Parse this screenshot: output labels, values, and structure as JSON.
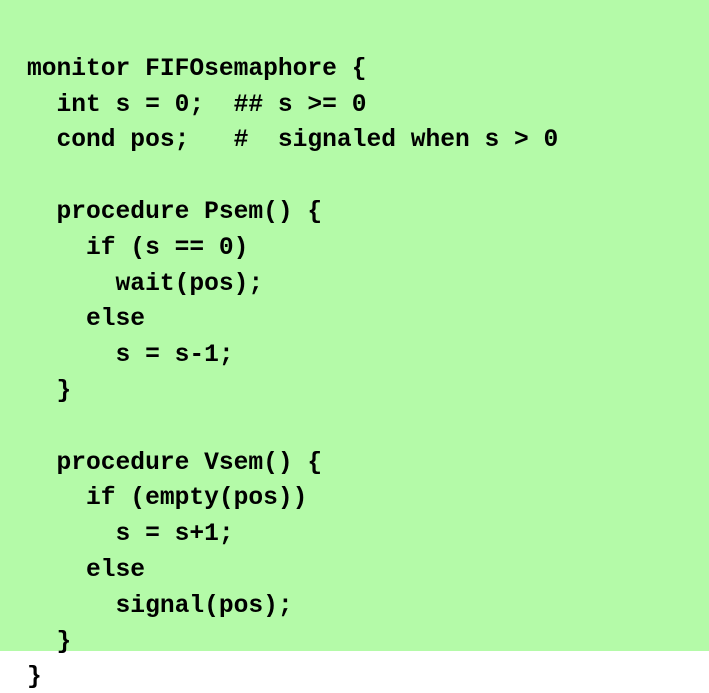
{
  "slide": {
    "background_color": "#b4faa8",
    "text_color": "#000000",
    "language": "monitor-pseudocode",
    "monitor_name": "FIFOsemaphore"
  },
  "code": {
    "full_text": "monitor FIFOsemaphore {\n  int s = 0;  ## s >= 0\n  cond pos;   #  signaled when s > 0\n\n  procedure Psem() {\n    if (s == 0)\n      wait(pos);\n    else\n      s = s-1;\n  }\n\n  procedure Vsem() {\n    if (empty(pos))\n      s = s+1;\n    else\n      signal(pos);\n  }\n}",
    "lines": [
      "monitor FIFOsemaphore {",
      "  int s = 0;  ## s >= 0",
      "  cond pos;   #  signaled when s > 0",
      "",
      "  procedure Psem() {",
      "    if (s == 0)",
      "      wait(pos);",
      "    else",
      "      s = s-1;",
      "  }",
      "",
      "  procedure Vsem() {",
      "    if (empty(pos))",
      "      s = s+1;",
      "    else",
      "      signal(pos);",
      "  }",
      "}"
    ]
  }
}
